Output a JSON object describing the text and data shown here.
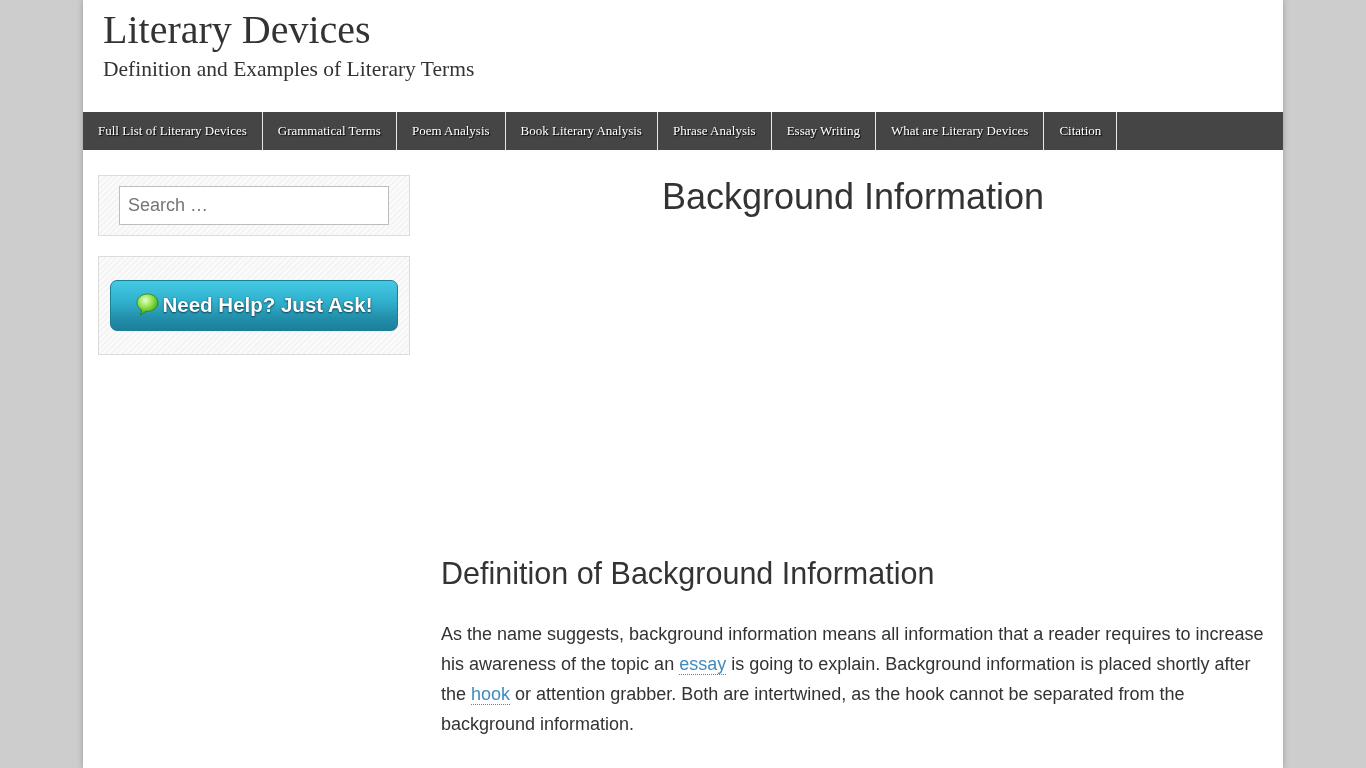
{
  "header": {
    "site_title": "Literary Devices",
    "tagline": "Definition and Examples of Literary Terms"
  },
  "nav": {
    "items": [
      {
        "label": "Full List of Literary Devices"
      },
      {
        "label": "Grammatical Terms"
      },
      {
        "label": "Poem Analysis"
      },
      {
        "label": "Book Literary Analysis"
      },
      {
        "label": "Phrase Analysis"
      },
      {
        "label": "Essay Writing"
      },
      {
        "label": "What are Literary Devices"
      },
      {
        "label": "Citation"
      }
    ]
  },
  "sidebar": {
    "search": {
      "placeholder": "Search …"
    },
    "help_button": {
      "label": "Need Help? Just Ask!"
    }
  },
  "article": {
    "title": "Background Information",
    "sections": [
      {
        "heading": "Definition of Background Information",
        "paragraphs": [
          [
            {
              "kind": "text",
              "text": "As the name suggests, background information means all information that a reader requires to increase his awareness of the topic an "
            },
            {
              "kind": "link",
              "text": "essay"
            },
            {
              "kind": "text",
              "text": " is going to explain. Background information is placed shortly after the "
            },
            {
              "kind": "link",
              "text": "hook"
            },
            {
              "kind": "text",
              "text": " or attention grabber. Both are intertwined, as the hook cannot be separated from the background information."
            }
          ]
        ]
      }
    ]
  }
}
